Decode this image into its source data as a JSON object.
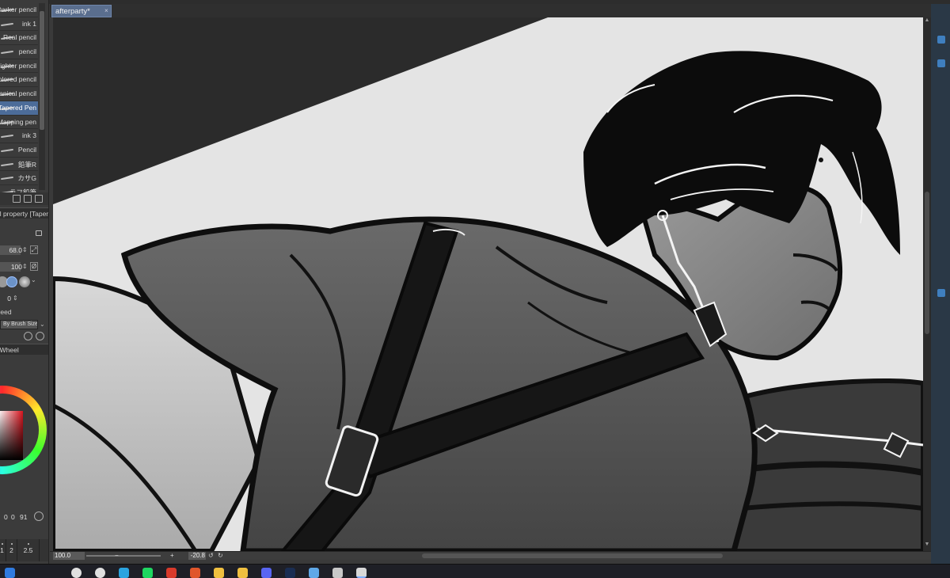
{
  "brushes": [
    {
      "name": "Darker pencil"
    },
    {
      "name": "ink 1"
    },
    {
      "name": "Real pencil"
    },
    {
      "name": "pencil"
    },
    {
      "name": "Lighter pencil"
    },
    {
      "name": "Colored pencil"
    },
    {
      "name": "mechanical pencil"
    },
    {
      "name": "Tapered Pen",
      "active": true
    },
    {
      "name": "Mapping pen"
    },
    {
      "name": "ink 3"
    },
    {
      "name": "Pencil"
    },
    {
      "name": "鉛筆R"
    },
    {
      "name": "カサG"
    },
    {
      "name": "ラフ鉛筆"
    }
  ],
  "tool_property": {
    "title": "Tool property [Tapered Pen]",
    "brush_size": "68.0",
    "opacity": "100",
    "anti_alias": "0",
    "speed_label": "Speed",
    "speed_select": "By Brush Size"
  },
  "color_wheel": {
    "title": "Color Wheel",
    "h": "0",
    "s": "0",
    "v": "91",
    "accent": "#d8141e"
  },
  "size_presets": [
    "1",
    "2",
    "2.5"
  ],
  "document": {
    "tab_title": "afterparty*",
    "close_glyph": "×"
  },
  "status_bar": {
    "zoom": "100.0",
    "minus": "−",
    "plus": "+",
    "rotation": "-20.8"
  },
  "taskbar": {
    "apps": [
      {
        "icon": "windows-icon",
        "color": "#2f7be0"
      },
      {
        "icon": "search-icon",
        "color": "#e0e0e0"
      },
      {
        "icon": "chrome-icon",
        "color": "#e0e0e0"
      },
      {
        "icon": "telegram-icon",
        "color": "#2aa4e0"
      },
      {
        "icon": "spotify-icon",
        "color": "#1ed760"
      },
      {
        "icon": "browser-icon",
        "color": "#d93a2b"
      },
      {
        "icon": "app-orange-icon",
        "color": "#e0562b"
      },
      {
        "icon": "folder-icon",
        "color": "#f0c040"
      },
      {
        "icon": "files-icon",
        "color": "#f0c040"
      },
      {
        "icon": "discord-icon",
        "color": "#5865f2"
      },
      {
        "icon": "photoshop-icon",
        "color": "#1a2d52"
      },
      {
        "icon": "pen-icon",
        "color": "#5fa8e8"
      },
      {
        "icon": "app-gray-icon",
        "color": "#c8c8c8"
      },
      {
        "icon": "clip-studio-icon",
        "color": "#d8d8d8"
      }
    ]
  }
}
